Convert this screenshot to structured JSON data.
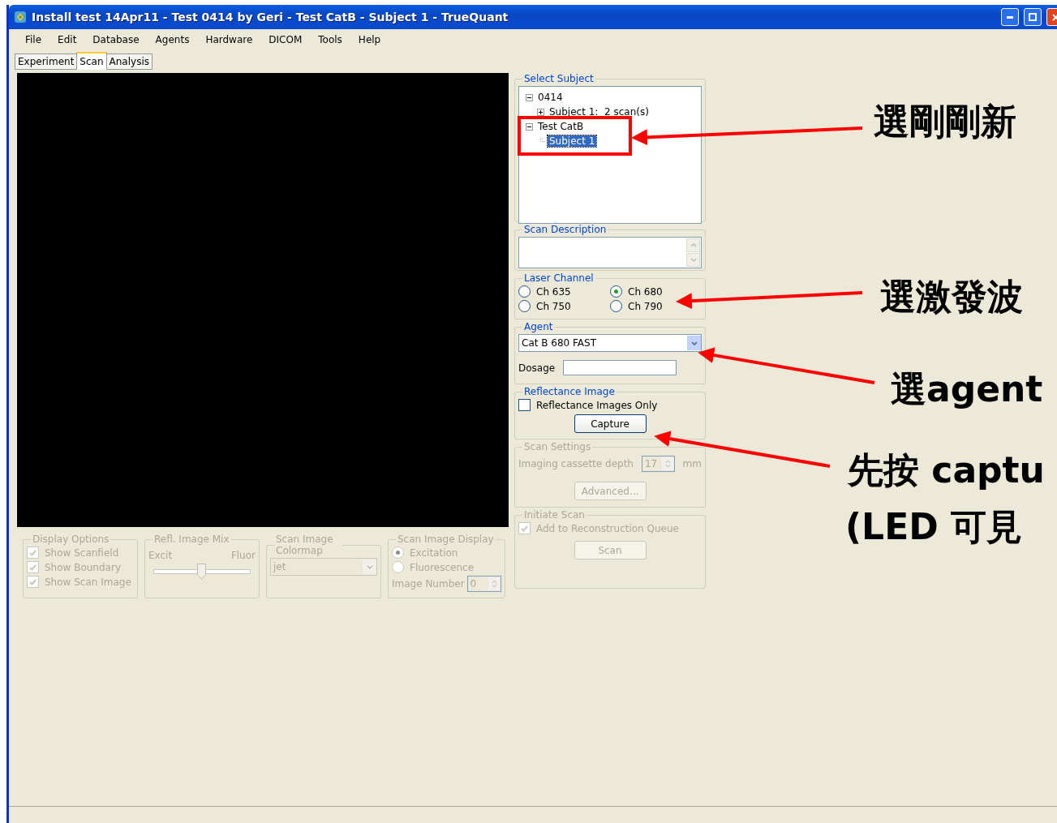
{
  "window": {
    "title": "Install test 14Apr11 - Test 0414 by Geri - Test CatB - Subject 1 - TrueQuant"
  },
  "menu": [
    "File",
    "Edit",
    "Database",
    "Agents",
    "Hardware",
    "DICOM",
    "Tools",
    "Help"
  ],
  "tabs": [
    {
      "label": "Experiment",
      "selected": false
    },
    {
      "label": "Scan",
      "selected": true
    },
    {
      "label": "Analysis",
      "selected": false
    }
  ],
  "select_subject": {
    "title": "Select Subject",
    "tree": [
      {
        "label": "0414",
        "expanded": true,
        "selected": false,
        "children": [
          {
            "label": "Subject 1:  2 scan(s)",
            "expanded": false,
            "selected": false
          }
        ]
      },
      {
        "label": "Test CatB",
        "expanded": true,
        "selected": false,
        "children": [
          {
            "label": "Subject 1",
            "selected": true
          }
        ]
      }
    ]
  },
  "scan_description": {
    "title": "Scan Description"
  },
  "laser_channel": {
    "title": "Laser Channel",
    "options": [
      {
        "label": "Ch 635",
        "selected": false
      },
      {
        "label": "Ch 680",
        "selected": true
      },
      {
        "label": "Ch 750",
        "selected": false
      },
      {
        "label": "Ch 790",
        "selected": false
      }
    ]
  },
  "agent": {
    "title": "Agent",
    "value": "Cat B 680 FAST",
    "dosage_label": "Dosage"
  },
  "reflectance_image": {
    "title": "Reflectance Image",
    "checkbox": {
      "label": "Reflectance Images Only",
      "checked": false
    },
    "button": "Capture"
  },
  "scan_settings": {
    "title": "Scan Settings",
    "disabled": true,
    "depth_label": "Imaging cassette depth",
    "depth_value": "17",
    "unit": "mm",
    "button": "Advanced..."
  },
  "initiate_scan": {
    "title": "Initiate Scan",
    "disabled": true,
    "checkbox": {
      "label": "Add to Reconstruction Queue",
      "checked": true
    },
    "button": "Scan"
  },
  "display_options": {
    "title": "Display Options",
    "disabled": true,
    "checkboxes": [
      {
        "label": "Show Scanfield",
        "checked": true
      },
      {
        "label": "Show Boundary",
        "checked": true
      },
      {
        "label": "Show Scan Image",
        "checked": true
      }
    ]
  },
  "refl_image_mix": {
    "title": "Refl. Image Mix",
    "left_label": "Excit",
    "right_label": "Fluor",
    "level": 0.5
  },
  "scan_image_colormap": {
    "title": "Scan Image Colormap",
    "value": "jet"
  },
  "scan_image_display": {
    "title": "Scan Image Display",
    "options": [
      {
        "label": "Excitation",
        "selected": true
      },
      {
        "label": "Fluorescence",
        "selected": false
      }
    ],
    "image_number_label": "Image Number",
    "image_number": "0"
  },
  "annotations": [
    {
      "text": "選剛剛新"
    },
    {
      "text": "選激發波"
    },
    {
      "text": "選agent"
    },
    {
      "text": "先按 captu"
    },
    {
      "text": "(LED 可見"
    }
  ]
}
